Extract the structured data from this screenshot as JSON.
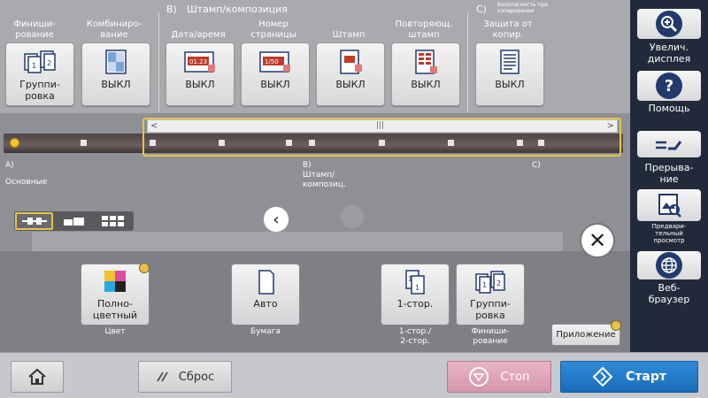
{
  "sections": {
    "b": {
      "letter": "B)",
      "title": "Штамп/композиция"
    },
    "c": {
      "letter": "C)",
      "title": "Безопасность при копировании"
    }
  },
  "function_buttons": [
    {
      "label": "Финиши-\nрование",
      "value": "Группи-\nровка",
      "icon": "staple-group-icon"
    },
    {
      "label": "Комбиниро-\nвание",
      "value": "ВЫКЛ",
      "icon": "combine-icon"
    },
    {
      "label": "Дата/время",
      "value": "ВЫКЛ",
      "icon": "datetime-icon",
      "icon_text": "01.23"
    },
    {
      "label": "Номер\nстраницы",
      "value": "ВЫКЛ",
      "icon": "page-number-icon",
      "icon_text": "1/50"
    },
    {
      "label": "Штамп",
      "value": "ВЫКЛ",
      "icon": "stamp-icon"
    },
    {
      "label": "Повторяющ.\nштамп",
      "value": "ВЫКЛ",
      "icon": "repeat-stamp-icon"
    },
    {
      "label": "Защита от\nкопир.",
      "value": "ВЫКЛ",
      "icon": "copy-protect-icon"
    }
  ],
  "nav": {
    "labels": {
      "a_letter": "A)",
      "a_name": "Основные",
      "b_name": "B)\nШтамп/\nкомпозиц.",
      "c_letter": "C)"
    }
  },
  "basic_buttons": [
    {
      "value": "Полно-\nцветный",
      "caption": "Цвет",
      "icon": "color-mode-icon"
    },
    {
      "value": "Авто",
      "caption": "Бумага",
      "icon": "paper-icon"
    },
    {
      "value": "1-стор.",
      "caption": "1-стор./\n2-стор.",
      "icon": "simplex-icon"
    },
    {
      "value": "Группи-\nровка",
      "caption": "Финиши-\nрование",
      "icon": "finishing-icon"
    }
  ],
  "app_button": "Приложение",
  "side_buttons": [
    {
      "label": "Увелич.\nдисплея",
      "icon": "magnify-icon"
    },
    {
      "label": "Помощь",
      "icon": "help-icon"
    },
    {
      "label": "Прерыва-\nние",
      "icon": "interrupt-icon"
    },
    {
      "label": "Предвари-\nтельный\nпросмотр",
      "icon": "preview-icon"
    },
    {
      "label": "Веб-\nбраузер",
      "icon": "web-browser-icon"
    }
  ],
  "bottom": {
    "reset": "Сброс",
    "stop": "Стоп",
    "start": "Старт"
  },
  "colors": {
    "accent_yellow": "#e8c34a",
    "start_blue": "#1a6dba",
    "stop_pink": "#d696ae",
    "sidebar_navy": "#212a3a"
  }
}
